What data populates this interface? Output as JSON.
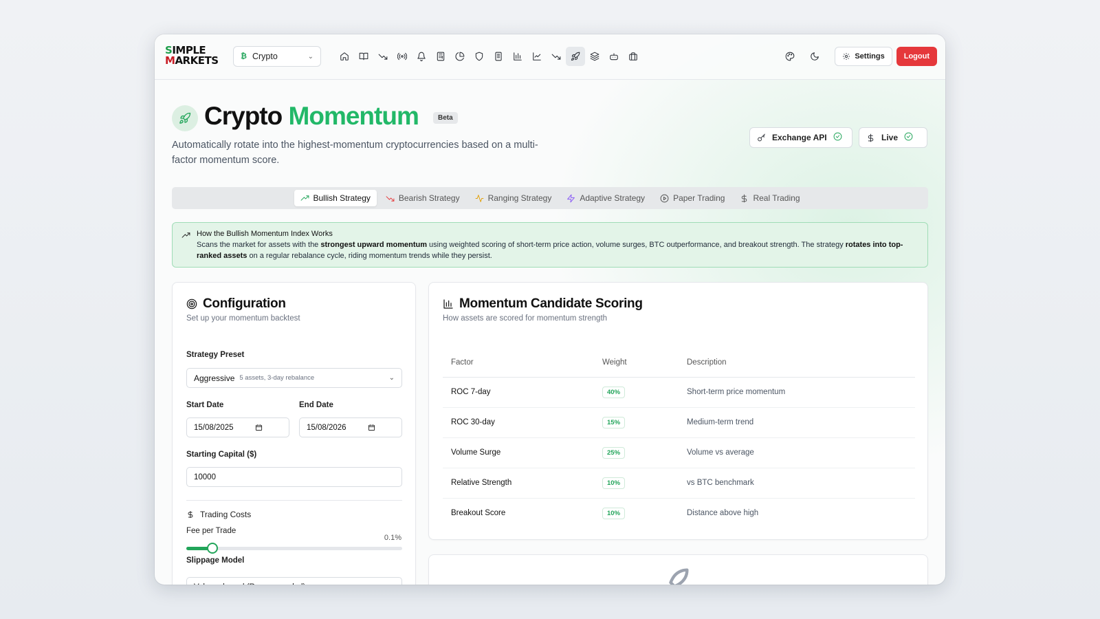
{
  "brand": {
    "line1": "SIMPLE",
    "line2": "MARKETS"
  },
  "market_select": {
    "value": "Crypto",
    "icon": "bitcoin-icon"
  },
  "nav": {
    "icons": [
      "home-icon",
      "book-icon",
      "trend-down-icon",
      "radio-icon",
      "bell-icon",
      "calculator-icon",
      "pie-chart-icon",
      "shield-icon",
      "file-icon",
      "bar-chart-icon",
      "line-chart-icon",
      "trend-down-icon",
      "rocket-icon",
      "layers-icon",
      "bot-icon",
      "briefcase-icon"
    ],
    "active_index": 12
  },
  "top_right": {
    "settings_label": "Settings",
    "logout_label": "Logout"
  },
  "header": {
    "title_main": "Crypto",
    "title_accent": "Momentum",
    "badge": "Beta",
    "subtitle": "Automatically rotate into the highest-momentum cryptocurrencies based on a multi-factor momentum score."
  },
  "status": {
    "exchange_api": "Exchange API",
    "live": "Live"
  },
  "tabs": [
    {
      "label": "Bullish Strategy",
      "icon": "trend-up-icon",
      "active": true
    },
    {
      "label": "Bearish Strategy",
      "icon": "trend-down-icon",
      "active": false
    },
    {
      "label": "Ranging Strategy",
      "icon": "activity-icon",
      "active": false
    },
    {
      "label": "Adaptive Strategy",
      "icon": "zap-icon",
      "active": false
    },
    {
      "label": "Paper Trading",
      "icon": "play-circle-icon",
      "active": false
    },
    {
      "label": "Real Trading",
      "icon": "dollar-icon",
      "active": false
    }
  ],
  "info": {
    "title": "How the Bullish Momentum Index Works",
    "p1": "Scans the market for assets with the ",
    "b1": "strongest upward momentum",
    "p2": " using weighted scoring of short-term price action, volume surges, BTC outperformance, and breakout strength. The strategy ",
    "b2": "rotates into top-ranked assets",
    "p3": " on a regular rebalance cycle, riding momentum trends while they persist."
  },
  "config": {
    "title": "Configuration",
    "subtitle": "Set up your momentum backtest",
    "preset_label": "Strategy Preset",
    "preset_value": "Aggressive",
    "preset_hint": "5 assets, 3-day rebalance",
    "start_label": "Start Date",
    "start_value": "15/08/2025",
    "end_label": "End Date",
    "end_value": "15/08/2026",
    "capital_label": "Starting Capital ($)",
    "capital_value": "10000",
    "costs_title": "Trading Costs",
    "fee_label": "Fee per Trade",
    "fee_value": "0.1%",
    "fee_fraction": 0.12,
    "slippage_label": "Slippage Model",
    "slippage_value": "Volume-based (Recommended)"
  },
  "scoring": {
    "title": "Momentum Candidate Scoring",
    "subtitle": "How assets are scored for momentum strength",
    "columns": [
      "Factor",
      "Weight",
      "Description"
    ],
    "rows": [
      {
        "factor": "ROC 7-day",
        "weight": "40%",
        "description": "Short-term price momentum"
      },
      {
        "factor": "ROC 30-day",
        "weight": "15%",
        "description": "Medium-term trend"
      },
      {
        "factor": "Volume Surge",
        "weight": "25%",
        "description": "Volume vs average"
      },
      {
        "factor": "Relative Strength",
        "weight": "10%",
        "description": "vs BTC benchmark"
      },
      {
        "factor": "Breakout Score",
        "weight": "10%",
        "description": "Distance above high"
      }
    ]
  },
  "colors": {
    "accent": "#22b868",
    "logout": "#e5383b",
    "banner_bg": "#e3f4e8"
  }
}
